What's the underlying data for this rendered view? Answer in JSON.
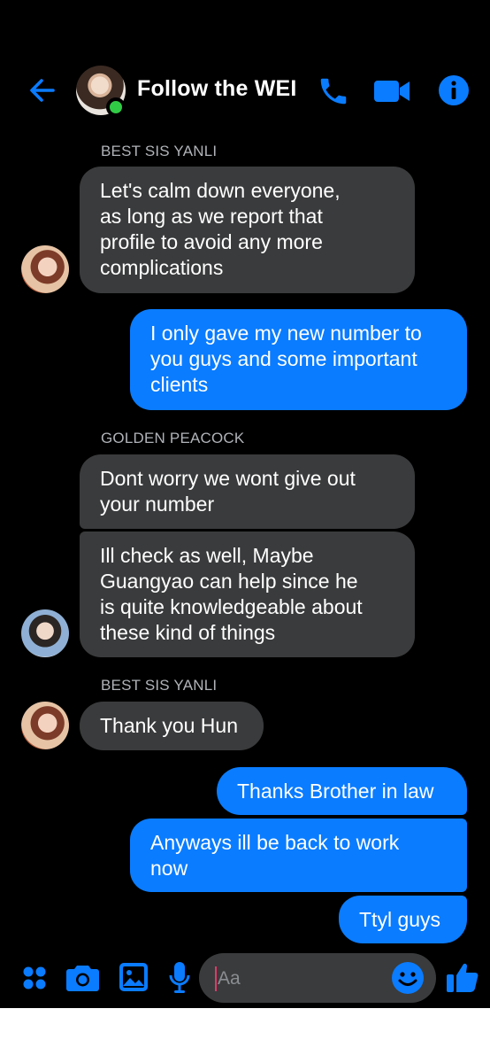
{
  "header": {
    "title": "Follow the WEI",
    "back_icon": "back-arrow-icon",
    "call_icon": "phone-icon",
    "video_icon": "video-camera-icon",
    "info_icon": "info-icon",
    "online": true,
    "accent": "#0a7cff"
  },
  "messages": [
    {
      "sender": "BEST SIS YANLI",
      "direction": "in",
      "lines": [
        "Let's calm down everyone,",
        "as long as we report that",
        "profile to avoid any more",
        "complications"
      ]
    },
    {
      "direction": "out",
      "lines": [
        "I only gave my new number to",
        "you guys and some important",
        "clients"
      ]
    },
    {
      "sender": "GOLDEN PEACOCK",
      "direction": "in",
      "lines": [
        "Dont worry we wont give out",
        "your number"
      ]
    },
    {
      "direction": "in",
      "lines": [
        "Ill check as well, Maybe",
        "Guangyao can help since he",
        "is quite knowledgeable about",
        "these kind of things"
      ]
    },
    {
      "sender": "BEST SIS YANLI",
      "direction": "in",
      "lines": [
        "Thank you Hun"
      ]
    },
    {
      "direction": "out",
      "lines": [
        "Thanks Brother in law"
      ]
    },
    {
      "direction": "out",
      "lines": [
        "Anyways ill be back to work",
        "now"
      ]
    },
    {
      "direction": "out",
      "lines": [
        "Ttyl guys"
      ]
    }
  ],
  "composer": {
    "placeholder": "Aa",
    "icons": [
      "apps-icon",
      "camera-icon",
      "gallery-icon",
      "microphone-icon",
      "emoji-icon",
      "thumbs-up-icon"
    ]
  },
  "colors": {
    "background": "#000000",
    "incoming_bubble": "#3a3b3c",
    "outgoing_bubble": "#0a7cff",
    "sender_name": "#b0b3b8",
    "online": "#31cc46"
  }
}
